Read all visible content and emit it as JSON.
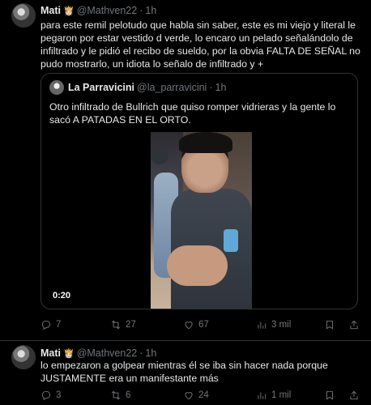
{
  "tweets": [
    {
      "name": "Mati",
      "badge": "👸🏻",
      "handle": "@Mathven22",
      "sep": "·",
      "time": "1h",
      "text": "para este remil pelotudo que habla sin saber, este es mi viejo y literal le pegaron por estar vestido d verde, lo encaro un pelado señalándolo de infiltrado y le pidió el recibo de sueldo, por la obvia FALTA DE SEÑAL no pudo mostrarlo, un idiota lo señalo de infiltrado y +",
      "quote": {
        "name": "La Parravicini",
        "handle": "@la_parravicini",
        "sep": "·",
        "time": "1h",
        "text": "Otro infiltrado de Bullrich que quiso romper vidrieras y la gente lo sacó A PATADAS EN EL ORTO.",
        "video_time": "0:20"
      },
      "stats": {
        "replies": "7",
        "retweets": "27",
        "likes": "67",
        "views": "3 mil"
      }
    },
    {
      "name": "Mati",
      "badge": "👸🏻",
      "handle": "@Mathven22",
      "sep": "·",
      "time": "1h",
      "text": "lo empezaron a golpear mientras él se iba sin hacer nada porque JUSTAMENTE era un manifestante más",
      "stats": {
        "replies": "3",
        "retweets": "6",
        "likes": "24",
        "views": "1 mil"
      }
    }
  ],
  "icons": [
    "reply-icon",
    "retweet-icon",
    "like-icon",
    "views-icon",
    "bookmark-icon",
    "share-icon"
  ]
}
